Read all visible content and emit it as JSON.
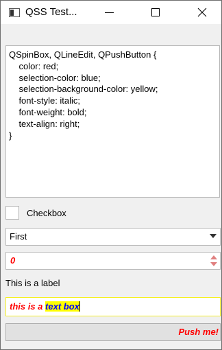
{
  "window": {
    "title": "QSS Test...",
    "minimize_icon": "minimize-icon",
    "maximize_icon": "maximize-icon",
    "close_icon": "close-icon"
  },
  "stylesheet_editor": {
    "text": "QSpinBox, QLineEdit, QPushButton {\n    color: red;\n    selection-color: blue;\n    selection-background-color: yellow;\n    font-style: italic;\n    font-weight: bold;\n    text-align: right;\n}"
  },
  "checkbox": {
    "label": "Checkbox",
    "checked": false
  },
  "combobox": {
    "selected": "First"
  },
  "spinbox": {
    "value": "0"
  },
  "label": {
    "text": "This is a label"
  },
  "lineedit": {
    "before": "this is a ",
    "selected": "text box"
  },
  "pushbutton": {
    "label": "Push me!"
  },
  "colors": {
    "text_red": "#ff0000",
    "selection_color": "#0000ff",
    "selection_background": "#ffff00",
    "lineedit_border": "#f5f020"
  }
}
